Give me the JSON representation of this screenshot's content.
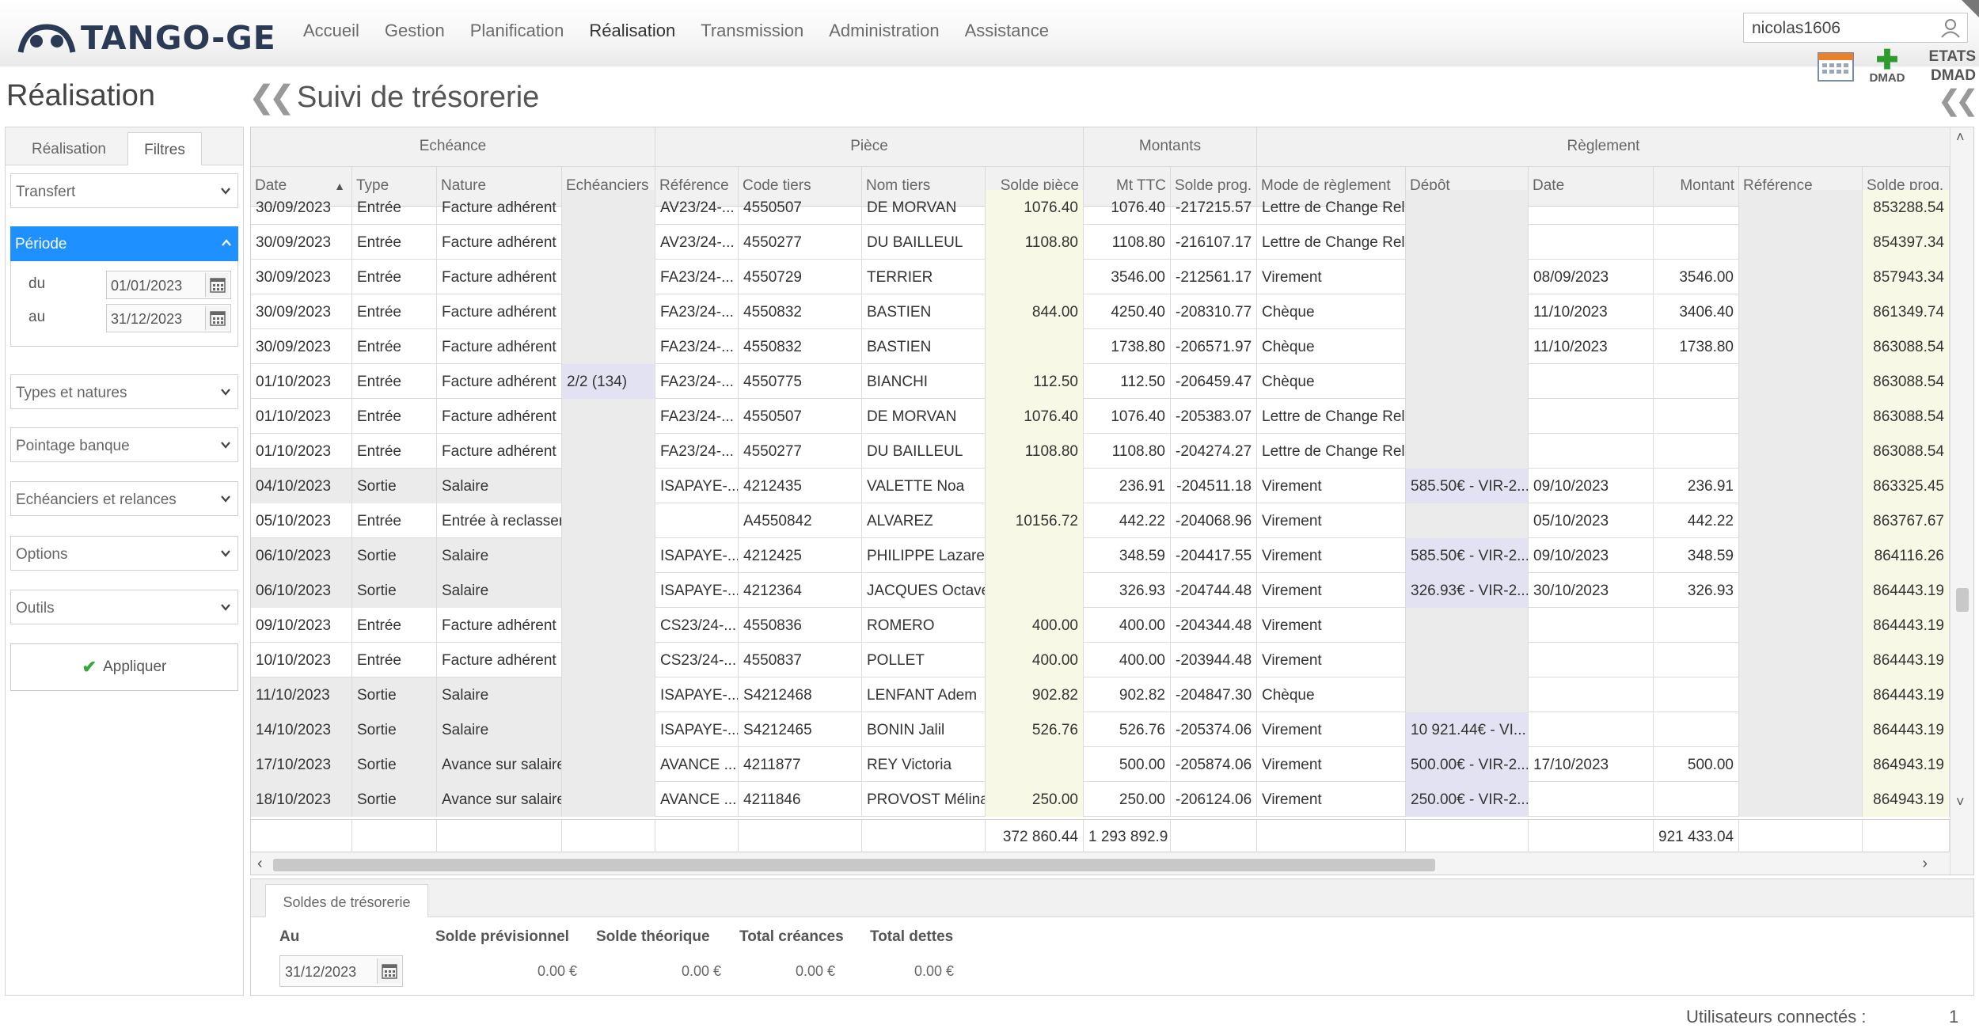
{
  "header": {
    "logo_text": "TANGO-GE",
    "menu": [
      "Accueil",
      "Gestion",
      "Planification",
      "Réalisation",
      "Transmission",
      "Administration",
      "Assistance"
    ],
    "active_menu": "Réalisation",
    "username": "nicolas1606",
    "toolbar": {
      "dmad_label": "DMAD",
      "etats_label": "ETATS",
      "etats_sub": "DMAD"
    }
  },
  "page": {
    "title": "Réalisation",
    "main_title": "Suivi de trésorerie"
  },
  "sidebar": {
    "tabs": [
      "Réalisation",
      "Filtres"
    ],
    "active_tab": "Filtres",
    "transfer_select": "Transfert",
    "periode": {
      "label": "Période",
      "du_label": "du",
      "au_label": "au",
      "du_value": "01/01/2023",
      "au_value": "31/12/2023"
    },
    "sections": [
      "Types et natures",
      "Pointage banque",
      "Echéanciers et relances",
      "Options",
      "Outils"
    ],
    "apply_label": "Appliquer"
  },
  "grid": {
    "groups": [
      "Echéance",
      "Pièce",
      "Montants",
      "Règlement"
    ],
    "columns": [
      "Date",
      "Type",
      "Nature",
      "Echéanciers",
      "Référence",
      "Code tiers",
      "Nom tiers",
      "Solde pièce",
      "Mt TTC",
      "Solde prog.",
      "Mode de règlement",
      "Dépôt",
      "Date",
      "Montant",
      "Référence",
      "Solde prog."
    ],
    "rows": [
      [
        "30/09/2023",
        "Entrée",
        "Facture adhérent",
        "",
        "AV23/24-...",
        "4550507",
        "DE MORVAN",
        "1076.40",
        "1076.40",
        "-217215.57",
        "Lettre de Change Rele",
        "",
        "",
        "",
        "",
        "853288.54"
      ],
      [
        "30/09/2023",
        "Entrée",
        "Facture adhérent",
        "",
        "AV23/24-...",
        "4550277",
        "DU BAILLEUL",
        "1108.80",
        "1108.80",
        "-216107.17",
        "Lettre de Change Rele",
        "",
        "",
        "",
        "",
        "854397.34"
      ],
      [
        "30/09/2023",
        "Entrée",
        "Facture adhérent",
        "",
        "FA23/24-...",
        "4550729",
        "TERRIER",
        "",
        "3546.00",
        "-212561.17",
        "Virement",
        "",
        "08/09/2023",
        "3546.00",
        "",
        "857943.34"
      ],
      [
        "30/09/2023",
        "Entrée",
        "Facture adhérent",
        "",
        "FA23/24-...",
        "4550832",
        "BASTIEN",
        "844.00",
        "4250.40",
        "-208310.77",
        "Chèque",
        "",
        "11/10/2023",
        "3406.40",
        "",
        "861349.74"
      ],
      [
        "30/09/2023",
        "Entrée",
        "Facture adhérent",
        "",
        "FA23/24-...",
        "4550832",
        "BASTIEN",
        "",
        "1738.80",
        "-206571.97",
        "Chèque",
        "",
        "11/10/2023",
        "1738.80",
        "",
        "863088.54"
      ],
      [
        "01/10/2023",
        "Entrée",
        "Facture adhérent",
        "2/2 (134)",
        "FA23/24-...",
        "4550775",
        "BIANCHI",
        "112.50",
        "112.50",
        "-206459.47",
        "Chèque",
        "",
        "",
        "",
        "",
        "863088.54"
      ],
      [
        "01/10/2023",
        "Entrée",
        "Facture adhérent",
        "",
        "FA23/24-...",
        "4550507",
        "DE MORVAN",
        "1076.40",
        "1076.40",
        "-205383.07",
        "Lettre de Change Rele",
        "",
        "",
        "",
        "",
        "863088.54"
      ],
      [
        "01/10/2023",
        "Entrée",
        "Facture adhérent",
        "",
        "FA23/24-...",
        "4550277",
        "DU BAILLEUL",
        "1108.80",
        "1108.80",
        "-204274.27",
        "Lettre de Change Rele",
        "",
        "",
        "",
        "",
        "863088.54"
      ],
      [
        "04/10/2023",
        "Sortie",
        "Salaire",
        "",
        "ISAPAYE-...",
        "4212435",
        "VALETTE Noa",
        "",
        "236.91",
        "-204511.18",
        "Virement",
        "585.50€ - VIR-2...",
        "09/10/2023",
        "236.91",
        "",
        "863325.45"
      ],
      [
        "05/10/2023",
        "Entrée",
        "Entrée à reclasser",
        "",
        "",
        "A4550842",
        "ALVAREZ",
        "10156.72",
        "442.22",
        "-204068.96",
        "Virement",
        "",
        "05/10/2023",
        "442.22",
        "",
        "863767.67"
      ],
      [
        "06/10/2023",
        "Sortie",
        "Salaire",
        "",
        "ISAPAYE-...",
        "4212425",
        "PHILIPPE Lazare",
        "",
        "348.59",
        "-204417.55",
        "Virement",
        "585.50€ - VIR-2...",
        "09/10/2023",
        "348.59",
        "",
        "864116.26"
      ],
      [
        "06/10/2023",
        "Sortie",
        "Salaire",
        "",
        "ISAPAYE-...",
        "4212364",
        "JACQUES Octave",
        "",
        "326.93",
        "-204744.48",
        "Virement",
        "326.93€ - VIR-2...",
        "30/10/2023",
        "326.93",
        "",
        "864443.19"
      ],
      [
        "09/10/2023",
        "Entrée",
        "Facture adhérent",
        "",
        "CS23/24-...",
        "4550836",
        "ROMERO",
        "400.00",
        "400.00",
        "-204344.48",
        "Virement",
        "",
        "",
        "",
        "",
        "864443.19"
      ],
      [
        "10/10/2023",
        "Entrée",
        "Facture adhérent",
        "",
        "CS23/24-...",
        "4550837",
        "POLLET",
        "400.00",
        "400.00",
        "-203944.48",
        "Virement",
        "",
        "",
        "",
        "",
        "864443.19"
      ],
      [
        "11/10/2023",
        "Sortie",
        "Salaire",
        "",
        "ISAPAYE-...",
        "S4212468",
        "LENFANT Adem",
        "902.82",
        "902.82",
        "-204847.30",
        "Chèque",
        "",
        "",
        "",
        "",
        "864443.19"
      ],
      [
        "14/10/2023",
        "Sortie",
        "Salaire",
        "",
        "ISAPAYE-...",
        "S4212465",
        "BONIN Jalil",
        "526.76",
        "526.76",
        "-205374.06",
        "Virement",
        "10 921.44€ - VI...",
        "",
        "",
        "",
        "864443.19"
      ],
      [
        "17/10/2023",
        "Sortie",
        "Avance sur salaire",
        "",
        "AVANCE ...",
        "4211877",
        "REY Victoria",
        "",
        "500.00",
        "-205874.06",
        "Virement",
        "500.00€ - VIR-2...",
        "17/10/2023",
        "500.00",
        "",
        "864943.19"
      ],
      [
        "18/10/2023",
        "Sortie",
        "Avance sur salaire",
        "",
        "AVANCE ...",
        "4211846",
        "PROVOST Mélina",
        "250.00",
        "250.00",
        "-206124.06",
        "Virement",
        "250.00€ - VIR-2...",
        "",
        "",
        "",
        "864943.19"
      ]
    ],
    "totals": {
      "solde_piece": "372 860.44",
      "mt_ttc": "1 293 892.9",
      "montant": "921 433.04"
    }
  },
  "soldes": {
    "tab_label": "Soldes de trésorerie",
    "au_label": "Au",
    "au_value": "31/12/2023",
    "headers": [
      "Solde prévisionnel",
      "Solde théorique",
      "Total créances",
      "Total dettes"
    ],
    "values": [
      "0.00 €",
      "0.00 €",
      "0.00 €",
      "0.00 €"
    ]
  },
  "footer": {
    "label": "Utilisateurs connectés :",
    "count": "1"
  },
  "colors": {
    "accent": "#1e90ff",
    "logo": "#2b3a55",
    "yellow_cell": "#f8f8e6",
    "purple_cell": "#e2e2f2",
    "gray_cell": "#ebebeb",
    "apply_check": "#3aa53a"
  }
}
